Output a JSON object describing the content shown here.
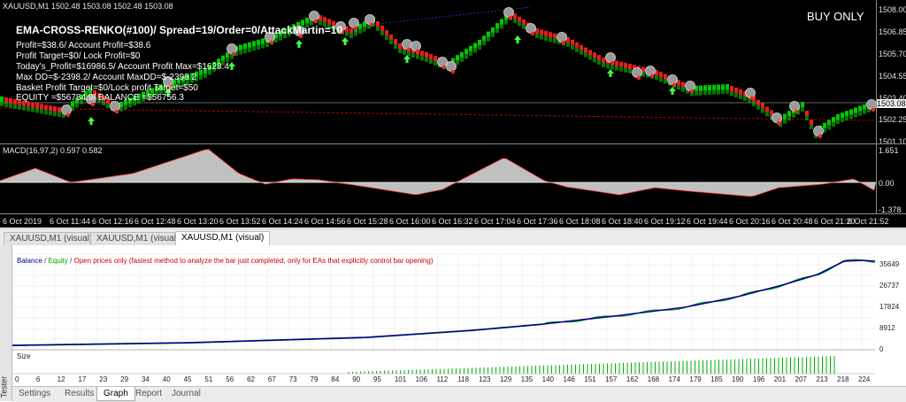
{
  "price_chart": {
    "header": {
      "symbol": "XAUUSD,M1",
      "ohlc": "1502.48 1503.08 1502.48 1503.08"
    },
    "ea_overlay": {
      "title": "EMA-CROSS-RENKO(#100)/ Spread=19/Order=0/AttackMartin=10",
      "lines": [
        "Profit=$38.6/ Account Profit=$38.6",
        "Profit Target=$0/ Lock Profit=$0",
        "Today's_Profit=$16986.5/ Account Profit Max=$1628.4",
        "Max DD=$-2398.2/ Account MaxDD=$-2398.2",
        "Basket Profit Target=$0/Lock profit Target=$50",
        "EQUITY =$56784.9/ BALANCE =$56756.3"
      ],
      "mode": "BUY ONLY"
    },
    "price_scale": [
      "1508.00",
      "1506.85",
      "1505.70",
      "1504.55",
      "1503.40",
      "1502.25",
      "1501.10"
    ],
    "current_price": "1503.08",
    "macd": {
      "label": "MACD(16,97,2) 0.597 0.582",
      "scale": [
        "1.651",
        "0.00",
        "-1.378"
      ]
    },
    "time_axis": [
      "6 Oct 2019",
      "6 Oct 11:44",
      "6 Oct 12:16",
      "6 Oct 12:48",
      "6 Oct 13:20",
      "6 Oct 13:52",
      "6 Oct 14:24",
      "6 Oct 14:56",
      "6 Oct 15:28",
      "6 Oct 16:00",
      "6 Oct 16:32",
      "6 Oct 17:04",
      "6 Oct 17:36",
      "6 Oct 18:08",
      "6 Oct 18:40",
      "6 Oct 19:12",
      "6 Oct 19:44",
      "6 Oct 20:16",
      "6 Oct 20:48",
      "6 Oct 21:20",
      "6 Oct 21:52"
    ],
    "colors": {
      "bull": "#00c800",
      "bear": "#ff2020",
      "marker": "#9a9a9a",
      "ma": "#b00000"
    }
  },
  "chart_tabs": [
    "XAUUSD,M1 (visual)",
    "XAUUSD,M1 (visual)",
    "XAUUSD,M1 (visual)"
  ],
  "tester": {
    "side_label": "Tester",
    "legend": {
      "balance": "Balance",
      "sep1": " / ",
      "equity": "Equity",
      "sep2": " / ",
      "mode": "Open prices only (fastest method to analyze the bar just completed, only for EAs that explicitly control bar opening)"
    },
    "size_label": "Size",
    "y_ticks": [
      "35649",
      "26737",
      "17824",
      "8912",
      "0"
    ],
    "x_ticks": [
      "0",
      "6",
      "12",
      "17",
      "23",
      "29",
      "34",
      "40",
      "45",
      "51",
      "56",
      "62",
      "67",
      "73",
      "79",
      "84",
      "90",
      "95",
      "101",
      "106",
      "112",
      "118",
      "123",
      "129",
      "135",
      "140",
      "146",
      "151",
      "157",
      "162",
      "168",
      "174",
      "179",
      "185",
      "190",
      "196",
      "201",
      "207",
      "213",
      "218",
      "224"
    ],
    "tabs": [
      "Settings",
      "Results",
      "Graph",
      "Report",
      "Journal"
    ],
    "active_tab": "Graph",
    "colors": {
      "balance": "#00008b",
      "equity": "#00a000",
      "mode": "#d00000",
      "volume": "#00b000"
    }
  }
}
